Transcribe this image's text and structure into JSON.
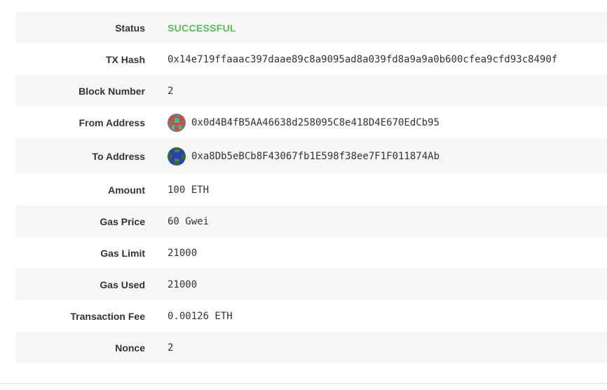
{
  "transaction": {
    "status": {
      "label": "Status",
      "value": "SUCCESSFUL"
    },
    "tx_hash": {
      "label": "TX Hash",
      "value": "0x14e719ffaaac397daae89c8a9095ad8a039fd8a9a9a0b600cfea9cfd93c8490f"
    },
    "block_number": {
      "label": "Block Number",
      "value": "2"
    },
    "from_address": {
      "label": "From Address",
      "value": "0x0d4B4fB5AA46638d258095C8e418D4E670EdCb95",
      "avatar_icon": "identicon-icon"
    },
    "to_address": {
      "label": "To Address",
      "value": "0xa8Db5eBCb8F43067fb1E598f38ee7F1F011874Ab",
      "avatar_icon": "identicon-icon"
    },
    "amount": {
      "label": "Amount",
      "value": "100 ETH"
    },
    "gas_price": {
      "label": "Gas Price",
      "value": "60 Gwei"
    },
    "gas_limit": {
      "label": "Gas Limit",
      "value": "21000"
    },
    "gas_used": {
      "label": "Gas Used",
      "value": "21000"
    },
    "transaction_fee": {
      "label": "Transaction Fee",
      "value": "0.00126 ETH"
    },
    "nonce": {
      "label": "Nonce",
      "value": "2"
    }
  },
  "colors": {
    "status_success": "#5cb85c",
    "row_shade": "#f6f6f6",
    "label_text": "#333333"
  }
}
